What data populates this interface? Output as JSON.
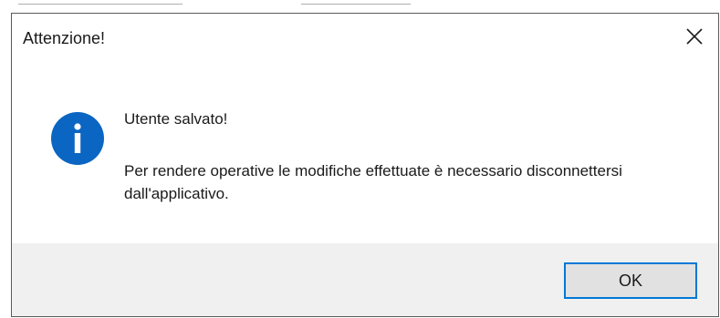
{
  "dialog": {
    "title": "Attenzione!",
    "close_icon": "close-icon",
    "icon": "info-icon",
    "message_title": "Utente salvato!",
    "message_body": "Per rendere operative le modifiche effettuate è necessario disconnettersi dall'applicativo.",
    "ok_label": "OK"
  },
  "colors": {
    "accent": "#0078d7",
    "info_icon_fill": "#0a66c2",
    "footer_bg": "#f0f0f0",
    "button_bg": "#e1e1e1"
  }
}
